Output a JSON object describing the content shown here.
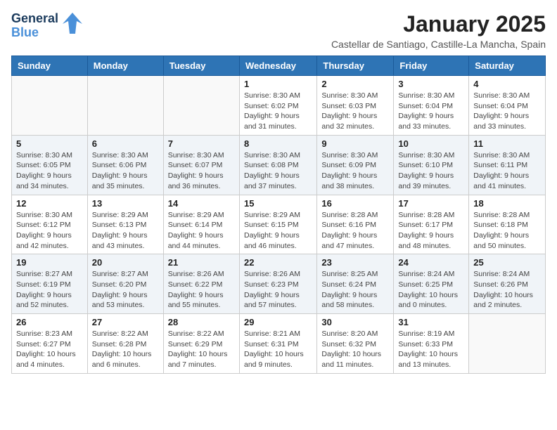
{
  "header": {
    "logo_line1": "General",
    "logo_line2": "Blue",
    "month_title": "January 2025",
    "location": "Castellar de Santiago, Castille-La Mancha, Spain"
  },
  "days_of_week": [
    "Sunday",
    "Monday",
    "Tuesday",
    "Wednesday",
    "Thursday",
    "Friday",
    "Saturday"
  ],
  "weeks": [
    [
      {
        "day": "",
        "info": ""
      },
      {
        "day": "",
        "info": ""
      },
      {
        "day": "",
        "info": ""
      },
      {
        "day": "1",
        "info": "Sunrise: 8:30 AM\nSunset: 6:02 PM\nDaylight: 9 hours and 31 minutes."
      },
      {
        "day": "2",
        "info": "Sunrise: 8:30 AM\nSunset: 6:03 PM\nDaylight: 9 hours and 32 minutes."
      },
      {
        "day": "3",
        "info": "Sunrise: 8:30 AM\nSunset: 6:04 PM\nDaylight: 9 hours and 33 minutes."
      },
      {
        "day": "4",
        "info": "Sunrise: 8:30 AM\nSunset: 6:04 PM\nDaylight: 9 hours and 33 minutes."
      }
    ],
    [
      {
        "day": "5",
        "info": "Sunrise: 8:30 AM\nSunset: 6:05 PM\nDaylight: 9 hours and 34 minutes."
      },
      {
        "day": "6",
        "info": "Sunrise: 8:30 AM\nSunset: 6:06 PM\nDaylight: 9 hours and 35 minutes."
      },
      {
        "day": "7",
        "info": "Sunrise: 8:30 AM\nSunset: 6:07 PM\nDaylight: 9 hours and 36 minutes."
      },
      {
        "day": "8",
        "info": "Sunrise: 8:30 AM\nSunset: 6:08 PM\nDaylight: 9 hours and 37 minutes."
      },
      {
        "day": "9",
        "info": "Sunrise: 8:30 AM\nSunset: 6:09 PM\nDaylight: 9 hours and 38 minutes."
      },
      {
        "day": "10",
        "info": "Sunrise: 8:30 AM\nSunset: 6:10 PM\nDaylight: 9 hours and 39 minutes."
      },
      {
        "day": "11",
        "info": "Sunrise: 8:30 AM\nSunset: 6:11 PM\nDaylight: 9 hours and 41 minutes."
      }
    ],
    [
      {
        "day": "12",
        "info": "Sunrise: 8:30 AM\nSunset: 6:12 PM\nDaylight: 9 hours and 42 minutes."
      },
      {
        "day": "13",
        "info": "Sunrise: 8:29 AM\nSunset: 6:13 PM\nDaylight: 9 hours and 43 minutes."
      },
      {
        "day": "14",
        "info": "Sunrise: 8:29 AM\nSunset: 6:14 PM\nDaylight: 9 hours and 44 minutes."
      },
      {
        "day": "15",
        "info": "Sunrise: 8:29 AM\nSunset: 6:15 PM\nDaylight: 9 hours and 46 minutes."
      },
      {
        "day": "16",
        "info": "Sunrise: 8:28 AM\nSunset: 6:16 PM\nDaylight: 9 hours and 47 minutes."
      },
      {
        "day": "17",
        "info": "Sunrise: 8:28 AM\nSunset: 6:17 PM\nDaylight: 9 hours and 48 minutes."
      },
      {
        "day": "18",
        "info": "Sunrise: 8:28 AM\nSunset: 6:18 PM\nDaylight: 9 hours and 50 minutes."
      }
    ],
    [
      {
        "day": "19",
        "info": "Sunrise: 8:27 AM\nSunset: 6:19 PM\nDaylight: 9 hours and 52 minutes."
      },
      {
        "day": "20",
        "info": "Sunrise: 8:27 AM\nSunset: 6:20 PM\nDaylight: 9 hours and 53 minutes."
      },
      {
        "day": "21",
        "info": "Sunrise: 8:26 AM\nSunset: 6:22 PM\nDaylight: 9 hours and 55 minutes."
      },
      {
        "day": "22",
        "info": "Sunrise: 8:26 AM\nSunset: 6:23 PM\nDaylight: 9 hours and 57 minutes."
      },
      {
        "day": "23",
        "info": "Sunrise: 8:25 AM\nSunset: 6:24 PM\nDaylight: 9 hours and 58 minutes."
      },
      {
        "day": "24",
        "info": "Sunrise: 8:24 AM\nSunset: 6:25 PM\nDaylight: 10 hours and 0 minutes."
      },
      {
        "day": "25",
        "info": "Sunrise: 8:24 AM\nSunset: 6:26 PM\nDaylight: 10 hours and 2 minutes."
      }
    ],
    [
      {
        "day": "26",
        "info": "Sunrise: 8:23 AM\nSunset: 6:27 PM\nDaylight: 10 hours and 4 minutes."
      },
      {
        "day": "27",
        "info": "Sunrise: 8:22 AM\nSunset: 6:28 PM\nDaylight: 10 hours and 6 minutes."
      },
      {
        "day": "28",
        "info": "Sunrise: 8:22 AM\nSunset: 6:29 PM\nDaylight: 10 hours and 7 minutes."
      },
      {
        "day": "29",
        "info": "Sunrise: 8:21 AM\nSunset: 6:31 PM\nDaylight: 10 hours and 9 minutes."
      },
      {
        "day": "30",
        "info": "Sunrise: 8:20 AM\nSunset: 6:32 PM\nDaylight: 10 hours and 11 minutes."
      },
      {
        "day": "31",
        "info": "Sunrise: 8:19 AM\nSunset: 6:33 PM\nDaylight: 10 hours and 13 minutes."
      },
      {
        "day": "",
        "info": ""
      }
    ]
  ]
}
